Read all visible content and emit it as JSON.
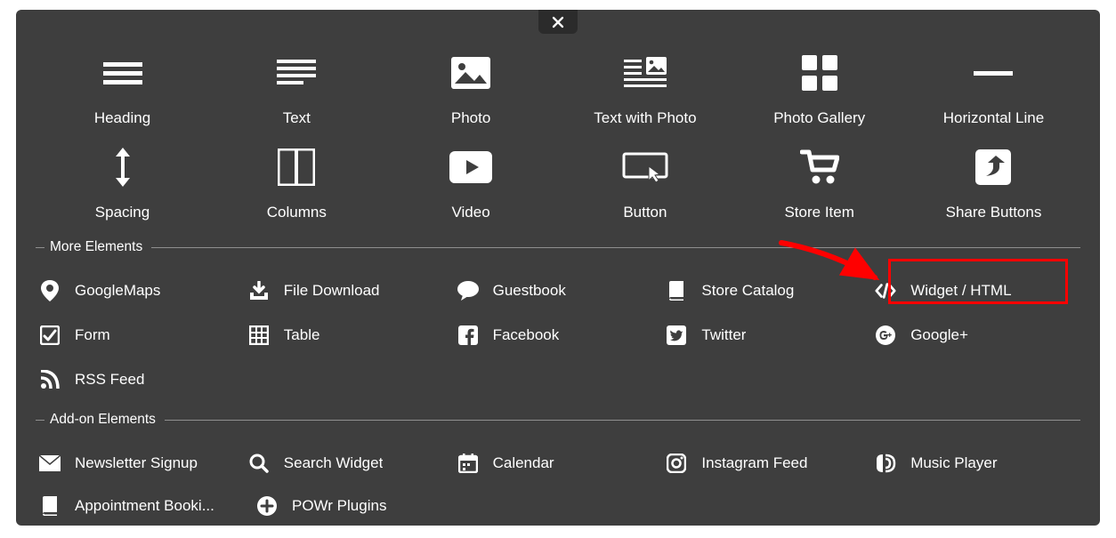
{
  "primary": [
    {
      "label": "Heading",
      "icon": "heading"
    },
    {
      "label": "Text",
      "icon": "text"
    },
    {
      "label": "Photo",
      "icon": "photo"
    },
    {
      "label": "Text with Photo",
      "icon": "text-with-photo"
    },
    {
      "label": "Photo Gallery",
      "icon": "photo-gallery"
    },
    {
      "label": "Horizontal Line",
      "icon": "horizontal-line"
    },
    {
      "label": "Spacing",
      "icon": "spacing"
    },
    {
      "label": "Columns",
      "icon": "columns"
    },
    {
      "label": "Video",
      "icon": "video"
    },
    {
      "label": "Button",
      "icon": "button"
    },
    {
      "label": "Store Item",
      "icon": "store-item"
    },
    {
      "label": "Share Buttons",
      "icon": "share-buttons"
    }
  ],
  "sections": {
    "more": "More Elements",
    "addon": "Add-on Elements"
  },
  "more": [
    {
      "label": "GoogleMaps",
      "icon": "map-pin"
    },
    {
      "label": "File Download",
      "icon": "download"
    },
    {
      "label": "Guestbook",
      "icon": "comment"
    },
    {
      "label": "Store Catalog",
      "icon": "book"
    },
    {
      "label": "Widget / HTML",
      "icon": "code"
    },
    {
      "label": "Form",
      "icon": "form"
    },
    {
      "label": "Table",
      "icon": "table"
    },
    {
      "label": "Facebook",
      "icon": "facebook"
    },
    {
      "label": "Twitter",
      "icon": "twitter"
    },
    {
      "label": "Google+",
      "icon": "googleplus"
    },
    {
      "label": "RSS Feed",
      "icon": "rss"
    }
  ],
  "addon": [
    {
      "label": "Newsletter Signup",
      "icon": "mail"
    },
    {
      "label": "Search Widget",
      "icon": "search"
    },
    {
      "label": "Calendar",
      "icon": "calendar"
    },
    {
      "label": "Instagram Feed",
      "icon": "instagram"
    },
    {
      "label": "Music Player",
      "icon": "music"
    },
    {
      "label": "Appointment Booki...",
      "icon": "book"
    },
    {
      "label": "POWr Plugins",
      "icon": "plus-circle"
    }
  ]
}
